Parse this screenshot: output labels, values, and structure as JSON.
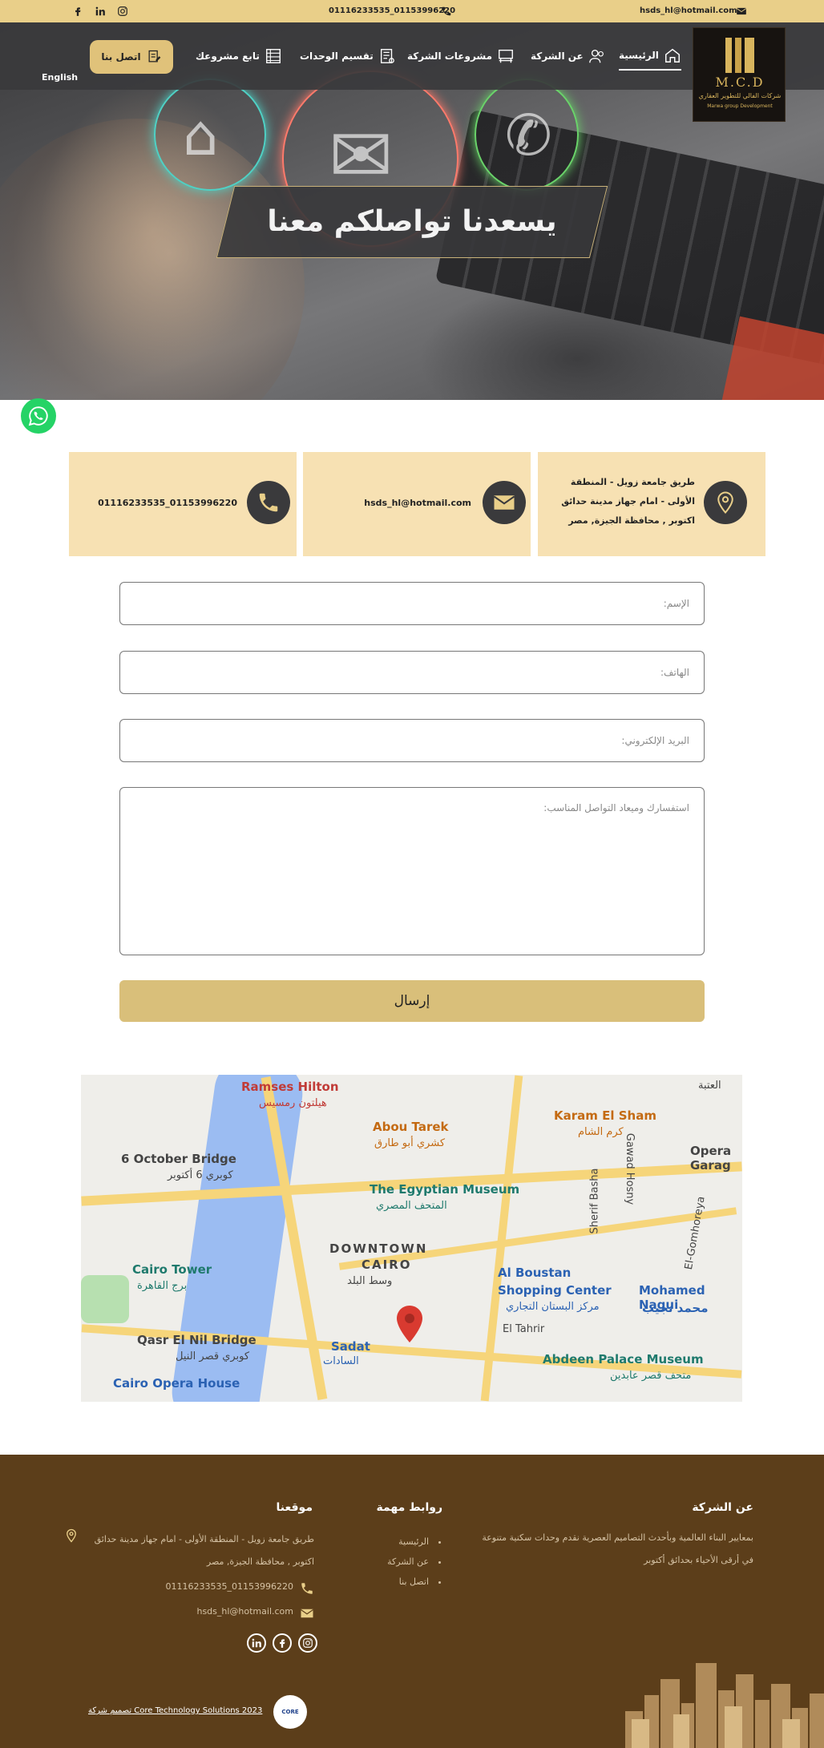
{
  "topbar": {
    "phone": "01116233535_01153996220",
    "email": "hsds_hl@hotmail.com",
    "social": [
      "facebook-icon",
      "linkedin-icon",
      "instagram-icon"
    ]
  },
  "logo": {
    "mark": "M.C.D",
    "arabic": "شركات الفالي للتطوير العقاري",
    "english": "Marwa group Development"
  },
  "nav": {
    "items": [
      {
        "label": "الرئيسية",
        "icon": "home-icon",
        "active": true
      },
      {
        "label": "عن الشركة",
        "icon": "users-icon"
      },
      {
        "label": "مشروعات الشركة",
        "icon": "desk-icon"
      },
      {
        "label": "تقسيم الوحدات",
        "icon": "units-icon"
      },
      {
        "label": "تابع مشروعك",
        "icon": "tracker-icon"
      }
    ],
    "contact_button": "اتصل بنا",
    "language": "English"
  },
  "hero": {
    "title": "يسعدنا تواصلكم معنا"
  },
  "contact_cards": {
    "address": "طريق جامعة زويل - المنطقة الأولى - امام جهاز مدينة حدائق اكتوبر , محافظة الجيزة, مصر",
    "email": "hsds_hl@hotmail.com",
    "phone": "01116233535_01153996220"
  },
  "form": {
    "name_placeholder": "الإسم:",
    "phone_placeholder": "الهاتف:",
    "email_placeholder": "البريد الإلكتروني:",
    "message_placeholder": "استفسارك وميعاد التواصل المناسب:",
    "submit_label": "إرسال"
  },
  "map": {
    "labels": {
      "ramses": "Ramses Hilton",
      "ramses_ar": "هيلتون رمسيس",
      "abu_tarek": "Abou Tarek",
      "abu_tarek_ar": "كشري أبو طارق",
      "karam": "Karam El Sham",
      "karam_ar": "كرم الشام",
      "opera_garage": "Opera Garag",
      "bridge6": "6 October Bridge",
      "bridge6_ar": "كوبري 6 أكتوبر",
      "museum": "The Egyptian Museum",
      "museum_ar": "المتحف المصري",
      "sherif": "Sherif Basha",
      "gawad": "Gawad Hosny",
      "gomhoreya": "El-Gomhoreya",
      "downtown1": "DOWNTOWN",
      "downtown2": "CAIRO",
      "downtown_ar": "وسط البلد",
      "tower": "Cairo Tower",
      "tower_ar": "برج القاهرة",
      "boustan": "Al Boustan",
      "boustan2": "Shopping Center",
      "boustan_ar": "مركز البستان التجاري",
      "naguib": "Mohamed Nagui",
      "naguib_ar": "محمد نجيب",
      "tahrir": "El Tahrir",
      "qasr": "Qasr El Nil Bridge",
      "qasr_ar": "كوبري قصر النيل",
      "sadat": "Sadat",
      "sadat_ar": "السادات",
      "abdeen": "Abdeen Palace Museum",
      "abdeen_ar": "متحف قصر عابدين",
      "opera": "Cairo Opera House",
      "ataba": "العتبة"
    }
  },
  "footer": {
    "about_title": "عن الشركة",
    "about_text": "بمعايير البناء العالمية وبأحدث التصاميم العصرية نقدم وحدات سكنية متنوعة في أرقى الأحياء بحدائق أكتوبر",
    "links_title": "روابط مهمة",
    "links": [
      "الرئيسية",
      "عن الشركة",
      "اتصل بنا"
    ],
    "location_title": "موقعنا",
    "address": "طريق جامعة زويل - المنطقة الأولى - امام جهاز مدينة حدائق اكتوبر , محافظة الجيزة, مصر",
    "phone": "01116233535_01153996220",
    "email": "hsds_hl@hotmail.com",
    "credit": "تصميم شركة Core Technology Solutions 2023",
    "credit_logo": "CORE"
  },
  "colors": {
    "gold": "#e9cf89",
    "footer_brown": "#5c3e1a",
    "card_beige": "#f7e1b3",
    "whatsapp_green": "#25d366"
  }
}
